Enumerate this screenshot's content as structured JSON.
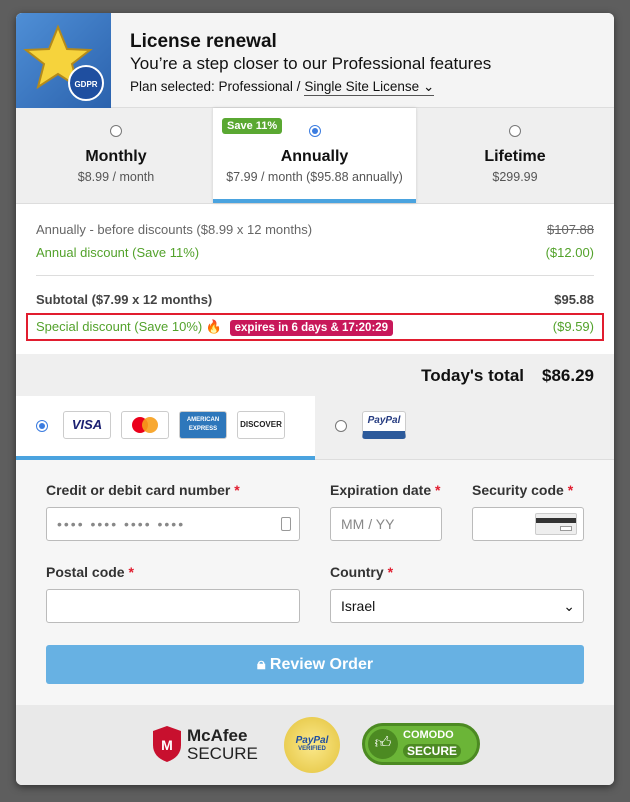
{
  "header": {
    "title": "License renewal",
    "subtitle": "You’re a step closer to our Professional features",
    "plan_prefix": "Plan selected: Professional /",
    "plan_option": "Single Site License",
    "logo_text": "GDPR"
  },
  "plans": [
    {
      "name": "Monthly",
      "price": "$8.99 / month",
      "selected": false
    },
    {
      "name": "Annually",
      "price": "$7.99 / month ($95.88 annually)",
      "selected": true,
      "badge": "Save 11%"
    },
    {
      "name": "Lifetime",
      "price": "$299.99",
      "selected": false
    }
  ],
  "summary": {
    "before_label": "Annually - before discounts ($8.99 x 12 months)",
    "before_value": "$107.88",
    "annual_discount_label": "Annual discount (Save 11%)",
    "annual_discount_value": "($12.00)",
    "subtotal_label": "Subtotal ($7.99 x 12 months)",
    "subtotal_value": "$95.88",
    "special_label": "Special discount (Save 10%)",
    "special_icon": "fire-icon",
    "expires": "expires in 6 days & 17:20:29",
    "special_value": "($9.59)"
  },
  "total": {
    "label": "Today's total",
    "value": "$86.29"
  },
  "payment": {
    "card_logos": [
      "VISA",
      "MasterCard",
      "AMERICAN EXPRESS",
      "DISCOVER"
    ],
    "paypal_label": "PayPal",
    "card_selected": true
  },
  "form": {
    "card_label": "Credit or debit card number",
    "card_placeholder": "•••• •••• •••• ••••",
    "exp_label": "Expiration date",
    "exp_placeholder": "MM / YY",
    "cvc_label": "Security code",
    "postal_label": "Postal code",
    "country_label": "Country",
    "country_value": "Israel",
    "required_mark": "*"
  },
  "button": {
    "label": "Review Order"
  },
  "trust": {
    "mcafee_line1": "McAfee",
    "mcafee_line2": "SECURE",
    "paypal_badge_line1": "PayPal",
    "paypal_badge_line2": "VERIFIED",
    "comodo_line1": "COMODO",
    "comodo_line2": "SECURE"
  },
  "colors": {
    "accent": "#4aa3df",
    "green": "#53a22b",
    "red": "#e11d2f",
    "expires_bg": "#c8185a",
    "button": "#67b1e3"
  }
}
